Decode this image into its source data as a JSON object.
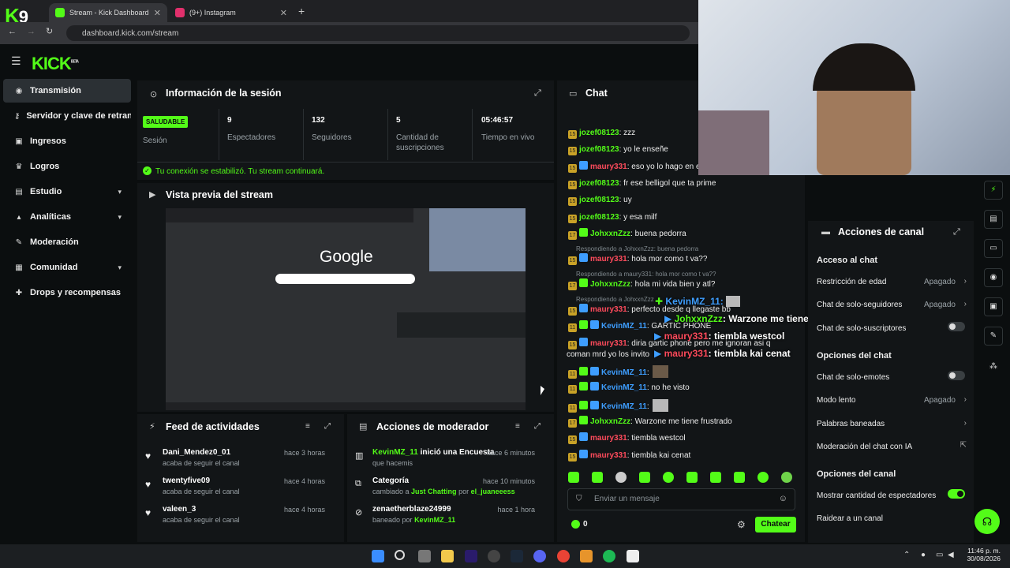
{
  "browser": {
    "tabs": [
      {
        "title": "Stream - Kick Dashboard",
        "color": "#53fc18"
      },
      {
        "title": "(9+) Instagram",
        "color": "#e1306c"
      }
    ],
    "url": "dashboard.kick.com/stream",
    "kick_tab_logo": "K",
    "kick_tab_num": "9"
  },
  "brand": {
    "logo": "KICK",
    "beta": "BETA"
  },
  "sidebar": {
    "items": [
      {
        "label": "Transmisión",
        "icon": "broadcast-icon"
      },
      {
        "label": "Servidor y clave de retransmisión",
        "icon": "key-icon"
      },
      {
        "label": "Ingresos",
        "icon": "money-icon"
      },
      {
        "label": "Logros",
        "icon": "trophy-icon"
      },
      {
        "label": "Estudio",
        "icon": "studio-icon"
      },
      {
        "label": "Analíticas",
        "icon": "analytics-icon"
      },
      {
        "label": "Moderación",
        "icon": "wrench-icon"
      },
      {
        "label": "Comunidad",
        "icon": "community-icon"
      },
      {
        "label": "Drops y recompensas",
        "icon": "gift-icon"
      }
    ]
  },
  "session": {
    "title": "Información de la sesión",
    "status_badge": "SALUDABLE",
    "status_label": "Sesión",
    "stats": [
      {
        "value": "9",
        "label": "Espectadores"
      },
      {
        "value": "132",
        "label": "Seguidores"
      },
      {
        "value": "5",
        "label": "Cantidad de suscripciones"
      },
      {
        "value": "05:46:57",
        "label": "Tiempo en vivo"
      }
    ],
    "connection_msg": "Tu conexión se estabilizó. Tu stream continuará."
  },
  "preview": {
    "title": "Vista previa del stream",
    "google": "Google"
  },
  "feed": {
    "title": "Feed de actividades",
    "items": [
      {
        "name": "Dani_Mendez0_01",
        "sub": "acaba de seguir el canal",
        "time": "hace 3 horas"
      },
      {
        "name": "twentyfive09",
        "sub": "acaba de seguir el canal",
        "time": "hace 4 horas"
      },
      {
        "name": "valeen_3",
        "sub": "acaba de seguir el canal",
        "time": "hace 4 horas"
      }
    ]
  },
  "mod_actions": {
    "title": "Acciones de moderador",
    "items": [
      {
        "user": "KevinMZ_11",
        "action": "inició una Encuesta",
        "sub": "que hacemis",
        "time": "hace 6 minutos"
      },
      {
        "user": "Categoría",
        "action": "",
        "sub_prefix": "cambiado a",
        "sub_link": "Just Chatting",
        "sub_mid": "por",
        "sub_user": "el_juaneeess",
        "time": "hace 10 minutos"
      },
      {
        "user": "zenaetherblaze24999",
        "action": "",
        "sub_prefix": "baneado por",
        "sub_user": "KevinMZ_11",
        "time": "hace 1 hora"
      }
    ]
  },
  "chat": {
    "title": "Chat",
    "messages": [
      {
        "user": "jozef08123",
        "color": "green",
        "text": ": zzz",
        "badges": [
          "15"
        ]
      },
      {
        "user": "jozef08123",
        "color": "green",
        "text": ": yo le enseñe",
        "badges": [
          "15"
        ]
      },
      {
        "user": "maury331",
        "color": "red",
        "text": ": eso yo lo hago en e",
        "badges": [
          "15",
          "b2"
        ]
      },
      {
        "user": "jozef08123",
        "color": "green",
        "text": ": fr ese belligol que ta prime",
        "badges": [
          "15"
        ]
      },
      {
        "user": "jozef08123",
        "color": "green",
        "text": ": uy",
        "badges": [
          "15"
        ]
      },
      {
        "user": "jozef08123",
        "color": "green",
        "text": ": y esa milf",
        "badges": [
          "15"
        ]
      },
      {
        "user": "JohxxnZzz",
        "color": "green",
        "text": ": buena pedorra",
        "badges": [
          "17",
          "b3"
        ]
      },
      {
        "reply": "Respondiendo a JohxxnZzz: buena pedorra"
      },
      {
        "user": "maury331",
        "color": "red",
        "text": ": hola mor como t va??",
        "badges": [
          "15",
          "b2"
        ]
      },
      {
        "reply": "Respondiendo a maury331: hola mor como t va??"
      },
      {
        "user": "JohxxnZzz",
        "color": "green",
        "text": ": hola mi vida bien y atl?",
        "badges": [
          "17",
          "b3"
        ]
      },
      {
        "reply": "Respondiendo a JohxxnZzz"
      },
      {
        "user": "maury331",
        "color": "red",
        "text": ": perfecto desde q llegaste bb",
        "badges": [
          "15",
          "b2"
        ]
      },
      {
        "user": "KevinMZ_11",
        "color": "blue",
        "text": ": GARTIC PHONE",
        "badges": [
          "11",
          "b3",
          "b2"
        ]
      },
      {
        "user": "maury331",
        "color": "red",
        "text": ": diria gartic phone pero me ignoran asi q",
        "badges": [
          "15",
          "b2"
        ]
      },
      {
        "cont": "coman mrd yo los invito"
      },
      {
        "user": "KevinMZ_11",
        "color": "blue",
        "text": ":",
        "badges": [
          "11",
          "b3",
          "b2"
        ]
      },
      {
        "user": "KevinMZ_11",
        "color": "blue",
        "text": ": no he visto",
        "badges": [
          "11",
          "b3",
          "b2"
        ]
      },
      {
        "user": "KevinMZ_11",
        "color": "blue",
        "text": ":",
        "badges": [
          "11",
          "b3",
          "b2"
        ]
      },
      {
        "user": "JohxxnZzz",
        "color": "green",
        "text": ": Warzone me tiene frustrado",
        "badges": [
          "17",
          "b3"
        ]
      },
      {
        "user": "maury331",
        "color": "red",
        "text": ": tiembla westcol",
        "badges": [
          "15",
          "b2"
        ]
      },
      {
        "user": "maury331",
        "color": "red",
        "text": ": tiembla kai cenat",
        "badges": [
          "15",
          "b2"
        ]
      }
    ],
    "overlay": [
      {
        "user": "KevinMZ_11",
        "text": ":",
        "color": "#3e9eff"
      },
      {
        "user": "JohxxnZzz",
        "text": ": Warzone me tiene frustrado",
        "color": "#53fc18"
      },
      {
        "user": "maury331",
        "text": ": tiembla westcol",
        "color": "#ff4b5c"
      },
      {
        "user": "maury331",
        "text": ": tiembla kai cenat",
        "color": "#ff4b5c"
      }
    ],
    "input_placeholder": "Enviar un mensaje",
    "points": "0",
    "send_label": "Chatear"
  },
  "channel_actions": {
    "title": "Acciones de canal",
    "chat_access": "Acceso al chat",
    "age_restriction": "Restricción de edad",
    "age_restriction_val": "Apagado",
    "followers_only": "Chat de solo-seguidores",
    "followers_only_val": "Apagado",
    "subs_only": "Chat de solo-suscriptores",
    "chat_options": "Opciones del chat",
    "emotes_only": "Chat de solo-emotes",
    "slow_mode": "Modo lento",
    "slow_mode_val": "Apagado",
    "banned_words": "Palabras baneadas",
    "ai_moderation": "Moderación del chat con IA",
    "channel_options": "Opciones del canal",
    "show_viewers": "Mostrar cantidad de espectadores",
    "raid": "Raidear a un canal"
  },
  "taskbar": {
    "time": "11:46 p. m.",
    "date": "30/08/2026"
  }
}
